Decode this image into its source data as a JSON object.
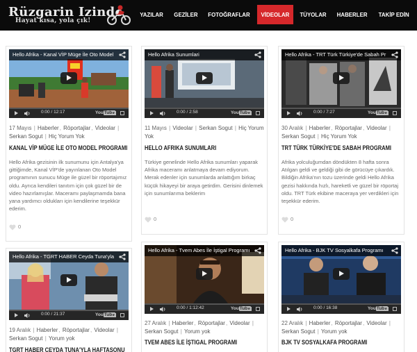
{
  "site": {
    "title": "Rüzgarin Izinde",
    "tagline": "Hayat kısa, yola çık!"
  },
  "nav": {
    "items": [
      {
        "label": "YAZILAR"
      },
      {
        "label": "GEZİLER"
      },
      {
        "label": "FOTOĞRAFLAR"
      },
      {
        "label": "VİDEOLAR"
      },
      {
        "label": "TÜYOLAR"
      },
      {
        "label": "HABERLER"
      },
      {
        "label": "TAKİP EDİN"
      }
    ],
    "active": "VİDEOLAR"
  },
  "posts": [
    {
      "video_title": "Hello Afrika - Kanal VİP Müge İle Oto Model",
      "time": "0:00 / 12:17",
      "date": "17 Mayıs",
      "categories": [
        "Haberler",
        "Röportajlar",
        "Videolar"
      ],
      "author": "Serkan Sogut",
      "comments": "Hiç Yorum Yok",
      "title": "KANAL VİP MÜGE İLE OTO MODEL PROGRAMI",
      "excerpt": "Hello Afrika gezisinin ilk sunumunu için Antalya'ya gittiğimde, Kanal VİP'de yayınlanan Oto Model programının sunucu Müge ile güzel bir röportajımız oldu. Ayrıca kendileri tanıtım için çok güzel bir de video hazırlamışlar. Maceramı paylaşmamda bana yana yardımcı oldukları için kendilerine teşekkür ederim.",
      "likes": "0"
    },
    {
      "video_title": "Hello Afrika Sunumlari",
      "time": "0:00 / 2:58",
      "date": "11 Mayıs",
      "categories": [
        "Videolar"
      ],
      "author": "Serkan Sogut",
      "comments": "Hiç Yorum Yok",
      "title": "HELLO AFRIKA SUNUMLARI",
      "excerpt": "Türkiye genelinde Hello Afrika sunumları yaparak Afrika maceramı anlatmaya devam ediyorum. Merak edenler için sunumlarda anlattığım birkaç küçük hikayeyi bir araya getirdim. Gerisini dinlemek için sunumlarıma beklerim",
      "likes": "0"
    },
    {
      "video_title": "Hello Afrika - TRT Türk Türkiye'de Sabah Pr",
      "time": "0:00 / 7:27",
      "date": "30 Aralık",
      "categories": [
        "Haberler",
        "Röportajlar",
        "Videolar"
      ],
      "author": "Serkan Sogut",
      "comments": "Hiç Yorum Yok",
      "title": "TRT TÜRK TÜRKİYE'DE SABAH PROGRAMI",
      "excerpt": "Afrika yolculuğumdan döndükten 8 hafta sonra Atılgan geldi ve geldiği gibi de görücüye çıkardık. Bildiğin Afrika'nın tozu üzerinde geldi Hello Afrika gezisi hakkında hızlı, hareketli ve güzel bir röportaj oldu. TRT Türk ekibine maceraya yer verdikleri için teşekkür ederim.",
      "likes": "0"
    },
    {
      "video_title": "Hello Afrika - TGRT HABER Ceyda Tuna'yla",
      "time": "0:00 / 21:37",
      "date": "19 Aralık",
      "categories": [
        "Haberler",
        "Röportajlar",
        "Videolar"
      ],
      "author": "Serkan Sogut",
      "comments": "Yorum yok",
      "title": "TGRT HABER CEYDA TUNA'YLA HAFTASONU",
      "excerpt": "",
      "likes": ""
    },
    {
      "video_title": "Hello Afrika - Tvem Abes İle İştigal Programı",
      "time": "0:00 / 1:12:42",
      "date": "27 Aralık",
      "categories": [
        "Haberler",
        "Röportajlar",
        "Videolar"
      ],
      "author": "Serkan Sogut",
      "comments": "Yorum yok",
      "title": "TVEM ABES İLE İŞTIGAL PROGRAMI",
      "excerpt": "",
      "likes": ""
    },
    {
      "video_title": "Hello Afrika - BJK TV Sosyalkafa Programı",
      "time": "0:00 / 16:38",
      "date": "22 Aralık",
      "categories": [
        "Haberler",
        "Röportajlar",
        "Videolar"
      ],
      "author": "Serkan Sogut",
      "comments": "Yorum yok",
      "title": "BJK TV SOSYALKAFA PROGRAMI",
      "excerpt": "",
      "likes": ""
    }
  ],
  "video_player": {
    "brand_you": "You",
    "brand_tube": "Tube"
  },
  "icons": {
    "share": "share-icon",
    "play": "play-icon",
    "volume": "volume-icon",
    "fullscreen": "fullscreen-icon",
    "like": "heart-icon"
  },
  "colors": {
    "header_bg": "#0b0b0b",
    "nav_active": "#d6282b",
    "card_border": "#e3e3e3",
    "title_text": "#1e1e1e"
  }
}
